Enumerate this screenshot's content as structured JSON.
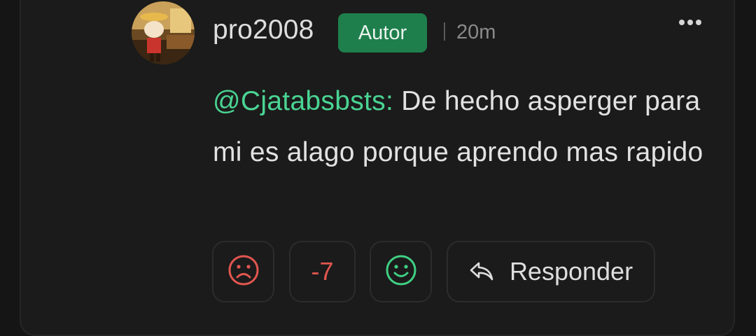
{
  "comment": {
    "author": "pro2008",
    "badge": "Autor",
    "time": "20m",
    "mention": "@Cjatabsbsts:",
    "text": " De hecho asperger para mi es alago porque aprendo mas rapido",
    "score": "-7",
    "reply_label": "Responder"
  },
  "colors": {
    "background": "#151515",
    "card": "#1b1b1b",
    "badge": "#1e7f4c",
    "mention": "#4ad493",
    "downvote": "#e1564f",
    "upvote": "#3fcf83"
  },
  "icons": {
    "more": "more-options-icon",
    "downvote": "sad-face-icon",
    "upvote": "happy-face-icon",
    "reply": "reply-arrow-icon"
  }
}
